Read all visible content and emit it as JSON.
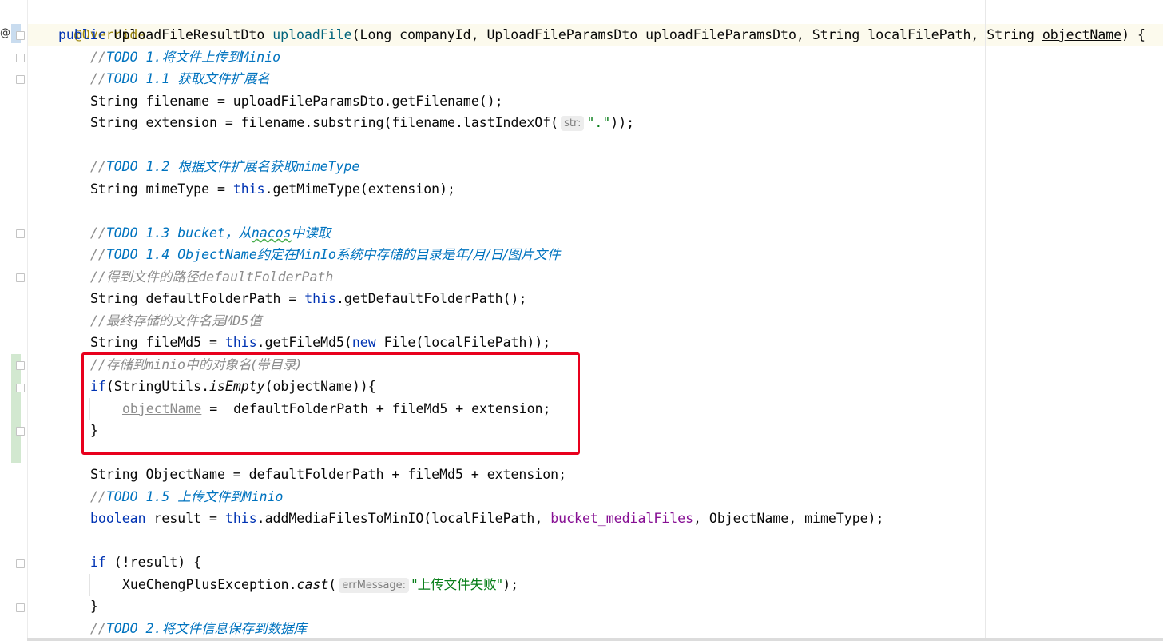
{
  "gutter": {
    "override_icon": "@",
    "override_icon_name": "override-method-icon"
  },
  "code": {
    "l1": {
      "annotation": "@Override"
    },
    "l2": {
      "kw_public": "public",
      "ret_type": "UploadFileResultDto",
      "method": "uploadFile",
      "params": "(Long companyId, UploadFileParamsDto uploadFileParamsDto, String localFilePath, String ",
      "param_last": "objectName",
      "tail": ") {"
    },
    "l3": {
      "prefix": "//",
      "todo": "TODO",
      "text": " 1.",
      "cn": "将文件上传到",
      "tail": "Minio"
    },
    "l4": {
      "prefix": "//",
      "todo": "TODO",
      "text": " 1.1 ",
      "cn": "获取文件扩展名"
    },
    "l5": {
      "text": "String filename = uploadFileParamsDto.getFilename();"
    },
    "l6": {
      "before": "String extension = filename.substring(filename.lastIndexOf(",
      "hint": "str:",
      "str": "\".\"",
      "after": "));"
    },
    "l7": {
      "prefix": "//",
      "todo": "TODO",
      "text": " 1.2 ",
      "cn": "根据文件扩展名获取",
      "tail": "mimeType"
    },
    "l8": {
      "before": "String mimeType = ",
      "kw_this": "this",
      "after": ".getMimeType(extension);"
    },
    "l9": {
      "prefix": "//",
      "todo": "TODO",
      "text": " 1.3 bucket",
      "cn1": "，从",
      "typo": "nacos",
      "cn2": "中读取"
    },
    "l10": {
      "prefix": "//",
      "todo": "TODO",
      "text": " 1.4 ObjectName",
      "cn1": "约定在",
      "mid": "MinIo",
      "cn2": "系统中存储的目录是年/月/日/图片文件"
    },
    "l11": {
      "prefix": "//",
      "cn": "得到文件的路径",
      "tail": "defaultFolderPath"
    },
    "l12": {
      "before": "String defaultFolderPath = ",
      "kw_this": "this",
      "after": ".getDefaultFolderPath();"
    },
    "l13": {
      "prefix": "//",
      "cn": "最终存储的文件名是",
      "tail": "MD5",
      "cn2": "值"
    },
    "l14": {
      "before": "String fileMd5 = ",
      "kw_this": "this",
      "mid": ".getFileMd5(",
      "kw_new": "new",
      "after": " File(localFilePath));"
    },
    "l15": {
      "prefix": "//",
      "cn1": "存储到",
      "mid": "minio",
      "cn2": "中的对象名(带目录)"
    },
    "l16": {
      "kw_if": "if",
      "before": "(StringUtils.",
      "italic": "isEmpty",
      "after": "(objectName)){"
    },
    "l17": {
      "unused": "objectName",
      "after": " =  defaultFolderPath + fileMd5 + extension;"
    },
    "l18": {
      "text": "}"
    },
    "l19": {
      "text": "String ObjectName = defaultFolderPath + fileMd5 + extension;"
    },
    "l20": {
      "prefix": "//",
      "todo": "TODO",
      "text": " 1.5 ",
      "cn": "上传文件到",
      "tail": "Minio"
    },
    "l21": {
      "kw_bool": "boolean",
      "before": " result = ",
      "kw_this": "this",
      "mid": ".addMediaFilesToMinIO(localFilePath, ",
      "field": "bucket_medialFiles",
      "after": ", ObjectName, mimeType);"
    },
    "l22": {
      "kw_if": "if",
      "after": " (!result) {"
    },
    "l23": {
      "before": "XueChengPlusException.",
      "italic": "cast",
      "open": "(",
      "hint": "errMessage:",
      "str": "\"上传文件失败\"",
      "after": ");"
    },
    "l24": {
      "text": "}"
    },
    "l25": {
      "prefix": "//",
      "todo": "TODO",
      "text": " 2.",
      "cn": "将文件信息保存到数据库"
    }
  },
  "colors": {
    "keyword": "#0033b3",
    "annotation": "#9e880d",
    "method": "#00627a",
    "comment": "#8c8c8c",
    "todo": "#0073bf",
    "field": "#871094",
    "string": "#067d17",
    "highlight_box": "#e8001d"
  }
}
